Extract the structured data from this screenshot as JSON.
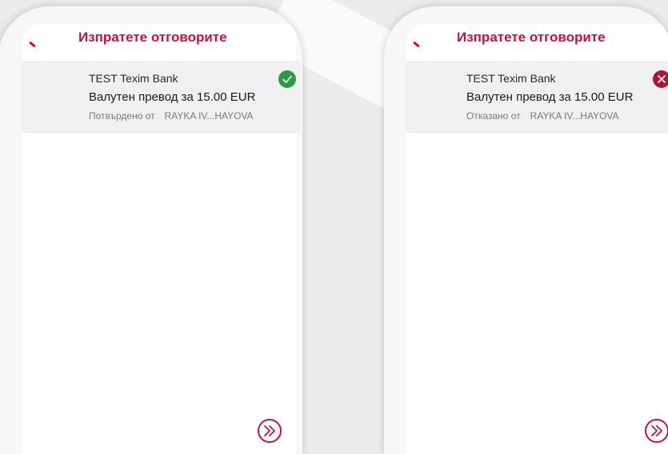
{
  "screens": [
    {
      "title": "Изпратете отговорите",
      "card": {
        "bank": "TEST Texim Bank",
        "description": "Валутен превод за 15.00 EUR",
        "status_label": "Потвърдено от",
        "signer": "RAYKA IV...HAYOVA",
        "status_icon": "checkmark-icon",
        "status_color": "#2f9a43"
      },
      "next_icon": "double-chevron-right-icon"
    },
    {
      "title": "Изпратете отговорите",
      "card": {
        "bank": "TEST Texim Bank",
        "description": "Валутен превод за 15.00 EUR",
        "status_label": "Отказано от",
        "signer": "RAYKA IV...HAYOVA",
        "status_icon": "x-icon",
        "status_color": "#b01534"
      },
      "next_icon": "double-chevron-right-icon"
    }
  ],
  "accent_color": "#c8103e"
}
